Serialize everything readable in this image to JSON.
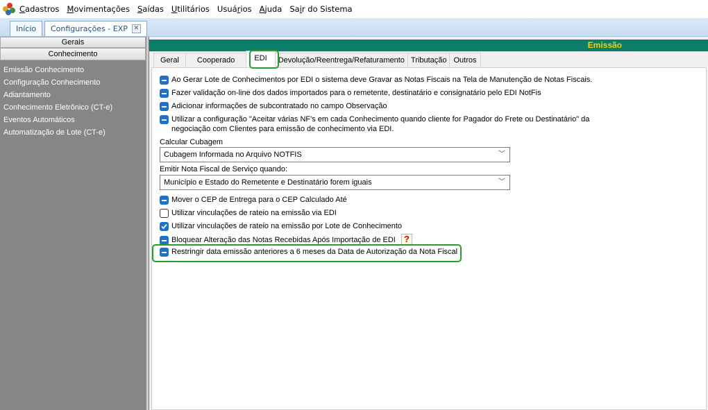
{
  "menubar": {
    "items": [
      {
        "pre": "",
        "ul": "C",
        "post": "adastros"
      },
      {
        "pre": "",
        "ul": "M",
        "post": "ovimentações"
      },
      {
        "pre": "",
        "ul": "S",
        "post": "aídas"
      },
      {
        "pre": "",
        "ul": "U",
        "post": "tilitários"
      },
      {
        "pre": "Usuá",
        "ul": "r",
        "post": "ios"
      },
      {
        "pre": "",
        "ul": "A",
        "post": "juda"
      },
      {
        "pre": "Sa",
        "ul": "i",
        "post": "r do Sistema"
      }
    ]
  },
  "doc_tabs": {
    "home": "Início",
    "active": "Configurações - EXP"
  },
  "left_panel": {
    "header_gerais": "Gerais",
    "header_conhecimento": "Conhecimento",
    "items": [
      "Emissão Conhecimento",
      "Configuração Conhecimento",
      "Adiantamento",
      "Conhecimento Eletrônico (CT-e)",
      "Eventos Automáticos",
      "Automatização de Lote (CT-e)"
    ]
  },
  "content": {
    "section_title": "Emissão",
    "tabs": [
      "Geral",
      "Cooperado",
      "EDI",
      "Devolução/Reentrega/Refaturamento",
      "Tributação",
      "Outros"
    ],
    "active_tab": "EDI",
    "options_top": [
      {
        "state": "indeterminate",
        "text": "Ao Gerar Lote de Conhecimentos por EDI o sistema deve Gravar as Notas Fiscais na Tela de Manutenção de Notas Fiscais."
      },
      {
        "state": "indeterminate",
        "text": "Fazer validação on-line dos dados importados para o remetente, destinatário e consignatário pelo EDI NotFis"
      },
      {
        "state": "indeterminate",
        "text": "Adicionar informações de subcontratado no campo Observação"
      },
      {
        "state": "indeterminate",
        "text": "Utilizar a configuração \"Aceitar várias NF's em cada Conhecimento quando cliente for Pagador do Frete ou Destinatário\" da",
        "text2": "negociação com Clientes para emissão  de conhecimento via EDI."
      }
    ],
    "cubagem_label": "Calcular Cubagem",
    "cubagem_value": "Cubagem Informada no Arquivo NOTFIS",
    "nf_servico_label": "Emitir Nota Fiscal de Serviço quando:",
    "nf_servico_value": "Município e Estado do Remetente e Destinatário forem iguais",
    "options_bottom": [
      {
        "state": "indeterminate",
        "text": "Mover o CEP de Entrega para o CEP Calculado Até"
      },
      {
        "state": "unchecked",
        "text": "Utilizar vinculações de rateio na emissão via EDI"
      },
      {
        "state": "checked",
        "text": "Utilizar vinculações de rateio na emissão por Lote de Conhecimento"
      },
      {
        "state": "indeterminate",
        "text": "Bloquear Alteração das Notas Recebidas Após Importação de EDI"
      },
      {
        "state": "indeterminate",
        "text": "Restringir data emissão anteriores a 6 meses da Data de Autorização da Nota Fiscal"
      }
    ],
    "help_glyph": "?"
  },
  "colors": {
    "section_bar": "#0c7d69",
    "section_text": "#f5d000",
    "checkbox": "#2170c8",
    "highlight": "#24a02c"
  }
}
